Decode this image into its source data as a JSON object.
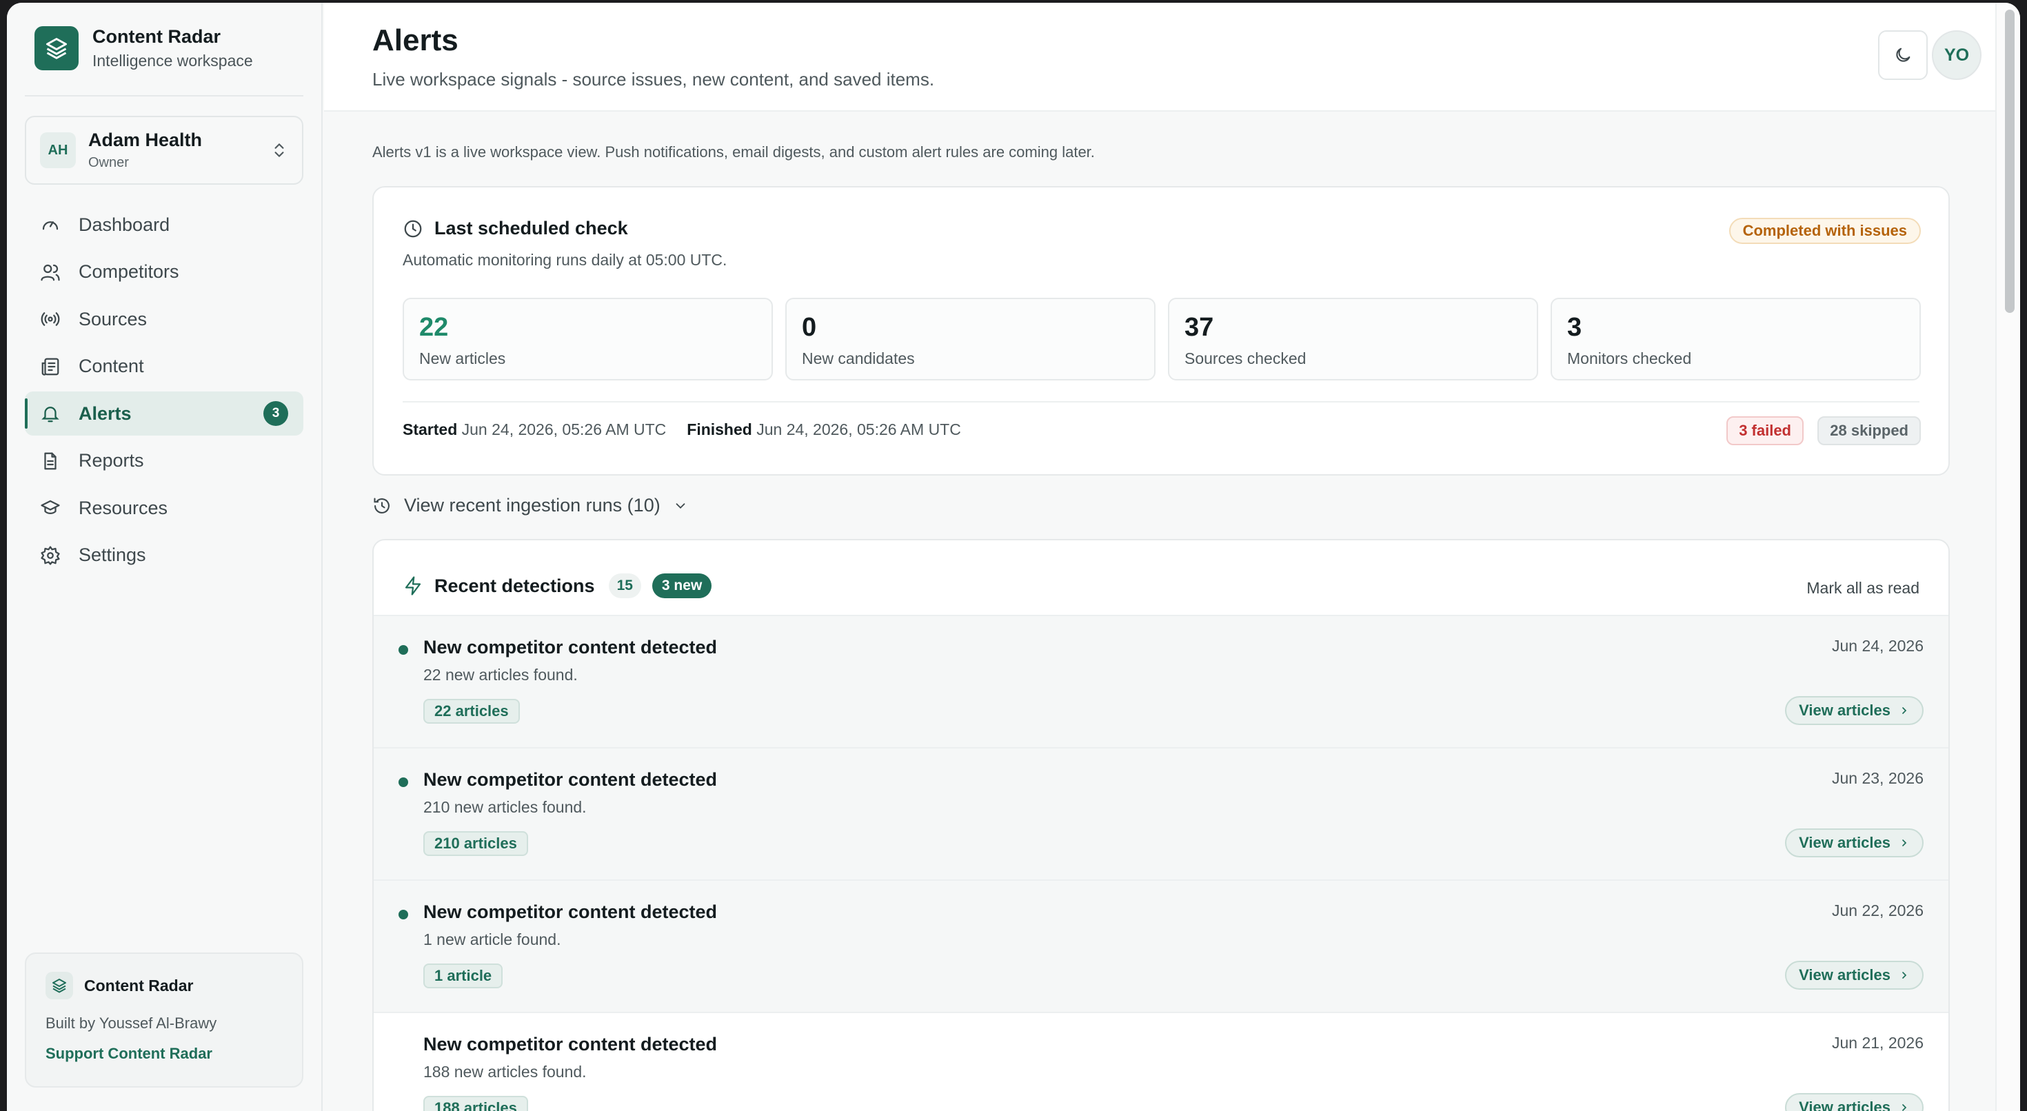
{
  "brand": {
    "title": "Content Radar",
    "subtitle": "Intelligence workspace"
  },
  "workspace": {
    "initials": "AH",
    "name": "Adam Health",
    "role": "Owner"
  },
  "nav": [
    {
      "label": "Dashboard",
      "icon": "gauge-icon"
    },
    {
      "label": "Competitors",
      "icon": "users-icon"
    },
    {
      "label": "Sources",
      "icon": "radio-icon"
    },
    {
      "label": "Content",
      "icon": "newspaper-icon"
    },
    {
      "label": "Alerts",
      "icon": "bell-icon",
      "badge": "3",
      "active": true
    },
    {
      "label": "Reports",
      "icon": "file-text-icon"
    },
    {
      "label": "Resources",
      "icon": "graduation-cap-icon"
    },
    {
      "label": "Settings",
      "icon": "gear-icon"
    }
  ],
  "sidebar_footer": {
    "title": "Content Radar",
    "built_by": "Built by Youssef Al-Brawy",
    "support": "Support Content Radar"
  },
  "header": {
    "title": "Alerts",
    "subtitle": "Live workspace signals - source issues, new content, and saved items.",
    "user_initials": "YO"
  },
  "notice": "Alerts v1 is a live workspace view. Push notifications, email digests, and custom alert rules are coming later.",
  "scheduled_check": {
    "title": "Last scheduled check",
    "subtitle": "Automatic monitoring runs daily at 05:00 UTC.",
    "status": "Completed with issues",
    "stats": [
      {
        "value": "22",
        "label": "New articles"
      },
      {
        "value": "0",
        "label": "New candidates"
      },
      {
        "value": "37",
        "label": "Sources checked"
      },
      {
        "value": "3",
        "label": "Monitors checked"
      }
    ],
    "started_label": "Started",
    "started": "Jun 24, 2026, 05:26 AM UTC",
    "finished_label": "Finished",
    "finished": "Jun 24, 2026, 05:26 AM UTC",
    "failed": "3 failed",
    "skipped": "28 skipped"
  },
  "runs_toggle": "View recent ingestion runs (10)",
  "detections": {
    "title": "Recent detections",
    "count": "15",
    "new_count": "3 new",
    "mark_all": "Mark all as read",
    "view_label": "View articles",
    "items": [
      {
        "title": "New competitor content detected",
        "subtitle": "22 new articles found.",
        "chip": "22 articles",
        "date": "Jun 24, 2026",
        "unread": true
      },
      {
        "title": "New competitor content detected",
        "subtitle": "210 new articles found.",
        "chip": "210 articles",
        "date": "Jun 23, 2026",
        "unread": true
      },
      {
        "title": "New competitor content detected",
        "subtitle": "1 new article found.",
        "chip": "1 article",
        "date": "Jun 22, 2026",
        "unread": true
      },
      {
        "title": "New competitor content detected",
        "subtitle": "188 new articles found.",
        "chip": "188 articles",
        "date": "Jun 21, 2026",
        "unread": false
      }
    ]
  },
  "colors": {
    "accent": "#1f6e59",
    "warning": "#b5630b",
    "danger": "#c23030"
  }
}
